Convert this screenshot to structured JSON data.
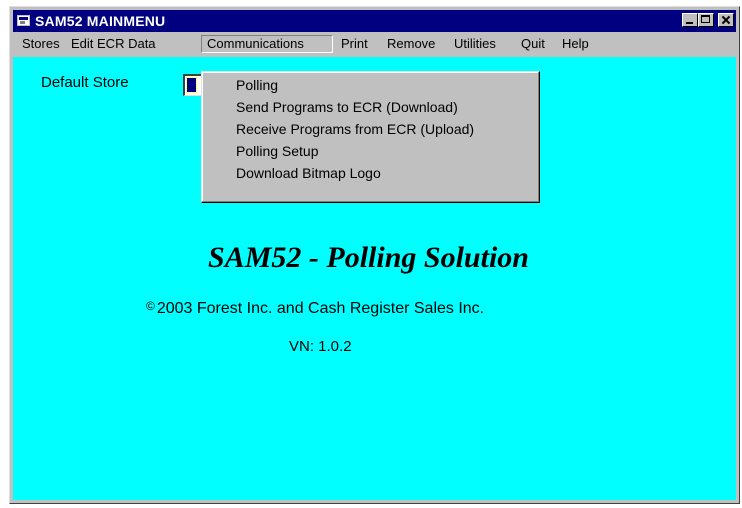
{
  "window": {
    "title": "SAM52 MAINMENU",
    "icon": "app-window-icon"
  },
  "menubar": {
    "items": [
      "Stores",
      "Edit ECR Data",
      "Communications",
      "Print",
      "Remove",
      "Utilities",
      "Quit",
      "Help"
    ],
    "active": "Communications"
  },
  "dropdown": {
    "items": [
      "Polling",
      "Send Programs to ECR (Download)",
      "Receive Programs from ECR (Upload)",
      "Polling Setup",
      "Download Bitmap Logo"
    ]
  },
  "main": {
    "default_store_label": "Default Store",
    "app_title": "SAM52 - Polling Solution",
    "copyright_symbol": "©",
    "copyright_text": "2003 Forest Inc. and Cash Register Sales Inc.",
    "version": "VN: 1.0.2"
  },
  "colors": {
    "titlebar": "#000080",
    "client_background": "#00ffff",
    "chrome": "#c0c0c0"
  }
}
